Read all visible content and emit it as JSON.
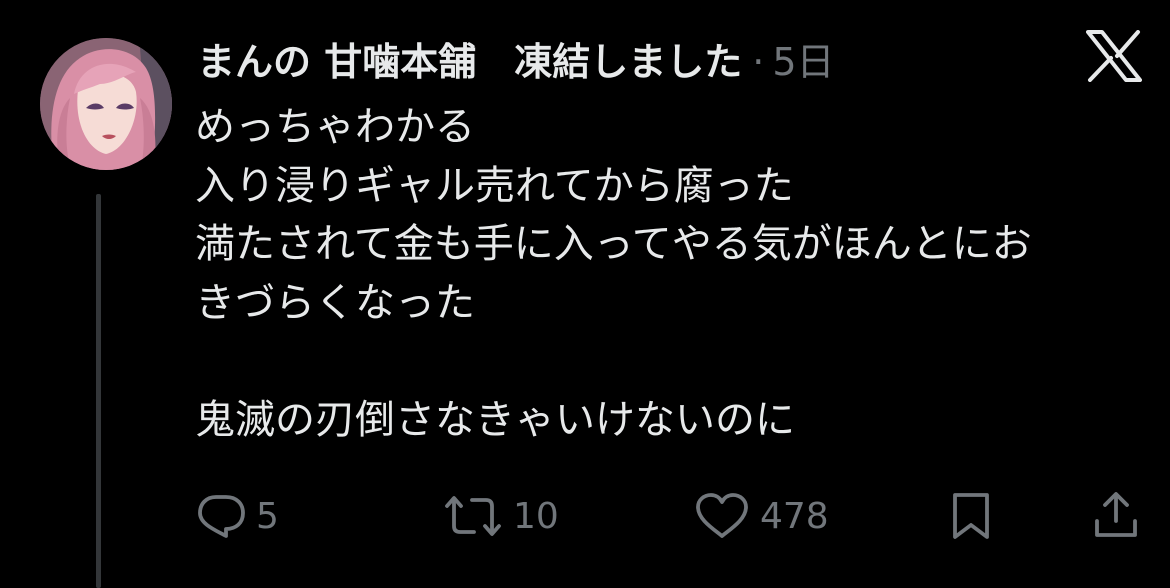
{
  "post": {
    "display_name": "まんの 甘噛本舗　凍結しました",
    "separator": "·",
    "time": "5日",
    "lines": [
      "めっちゃわかる",
      "入り浸りギャル売れてから腐った",
      "満たされて金も手に入ってやる気がほんとにお",
      "きづらくなった",
      "",
      "鬼滅の刃倒さなきゃいけないのに"
    ]
  },
  "actions": {
    "reply_count": "5",
    "repost_count": "10",
    "like_count": "478"
  },
  "icons": {
    "platform": "x-logo-icon",
    "reply": "reply-bubble-icon",
    "repost": "repost-arrows-icon",
    "like": "heart-icon",
    "bookmark": "bookmark-icon",
    "share": "share-upload-icon"
  },
  "colors": {
    "background": "#000000",
    "text_primary": "#e7e9ea",
    "text_secondary": "#71767b",
    "thread_line": "#333639"
  }
}
